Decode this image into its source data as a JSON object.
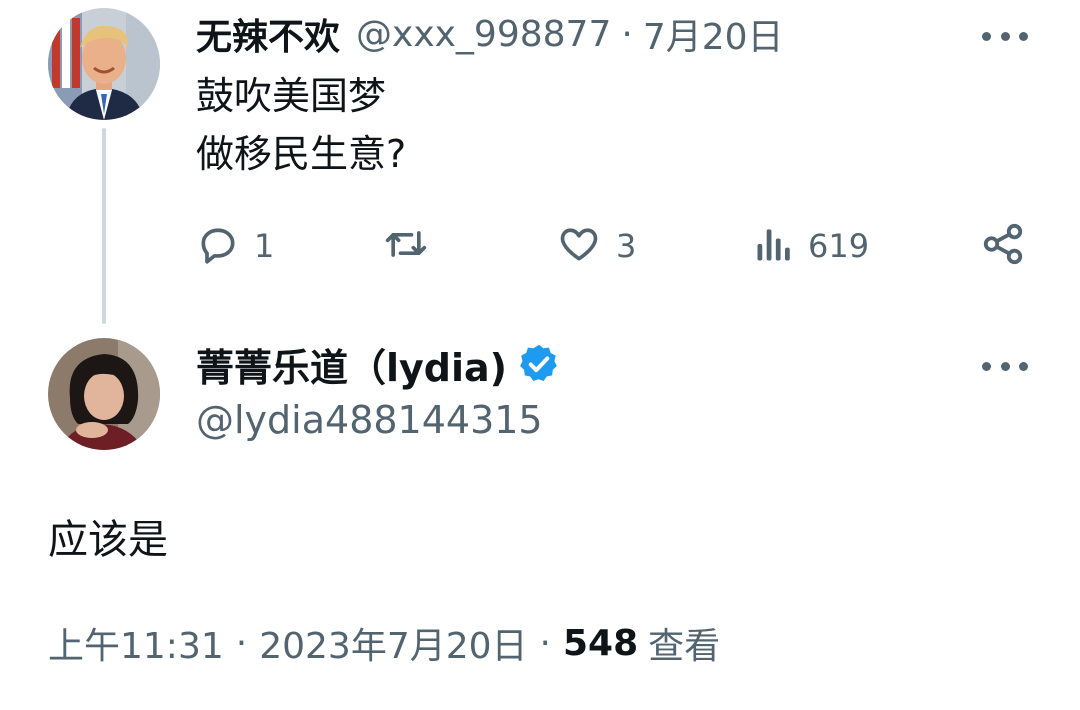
{
  "parent_tweet": {
    "display_name": "无辣不欢",
    "handle": "@xxx_998877",
    "separator": "·",
    "date": "7月20日",
    "text_lines": [
      "鼓吹美国梦",
      "做移民生意?"
    ],
    "actions": {
      "reply_count": "1",
      "like_count": "3",
      "view_count": "619"
    },
    "icons": {
      "reply": "reply-icon",
      "retweet": "retweet-icon",
      "like": "heart-icon",
      "views": "views-icon",
      "share": "share-icon",
      "more": "more-icon"
    }
  },
  "reply_tweet": {
    "display_name": "菁菁乐道（lydia)",
    "verified_icon": "verified-badge-icon",
    "handle": "@lydia488144315",
    "text": "应该是",
    "timestamp": "上午11:31",
    "separator": "·",
    "date": "2023年7月20日",
    "views_count": "548",
    "views_label": "查看"
  },
  "colors": {
    "text_primary": "#0f1419",
    "text_secondary": "#536471",
    "thread_line": "#cfd9de",
    "verified_blue": "#1d9bf0"
  }
}
